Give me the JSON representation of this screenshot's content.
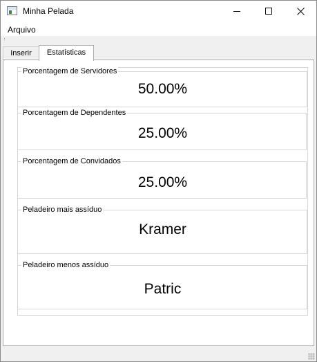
{
  "window": {
    "title": "Minha Pelada"
  },
  "menu": {
    "items": [
      "Arquivo"
    ]
  },
  "tabs": [
    {
      "label": "Inserir",
      "active": false
    },
    {
      "label": "Estatísticas",
      "active": true
    }
  ],
  "stats": {
    "servidores": {
      "label": "Porcentagem de Servidores",
      "value": "50.00%"
    },
    "dependentes": {
      "label": "Porcentagem de Dependentes",
      "value": "25.00%"
    },
    "convidados": {
      "label": "Porcentagem de Convidados",
      "value": "25.00%"
    },
    "mais_assiduo": {
      "label": "Peladeiro mais assíduo",
      "value": "Kramer"
    },
    "menos_assiduo": {
      "label": "Peladeiro menos assíduo",
      "value": "Patric"
    }
  }
}
